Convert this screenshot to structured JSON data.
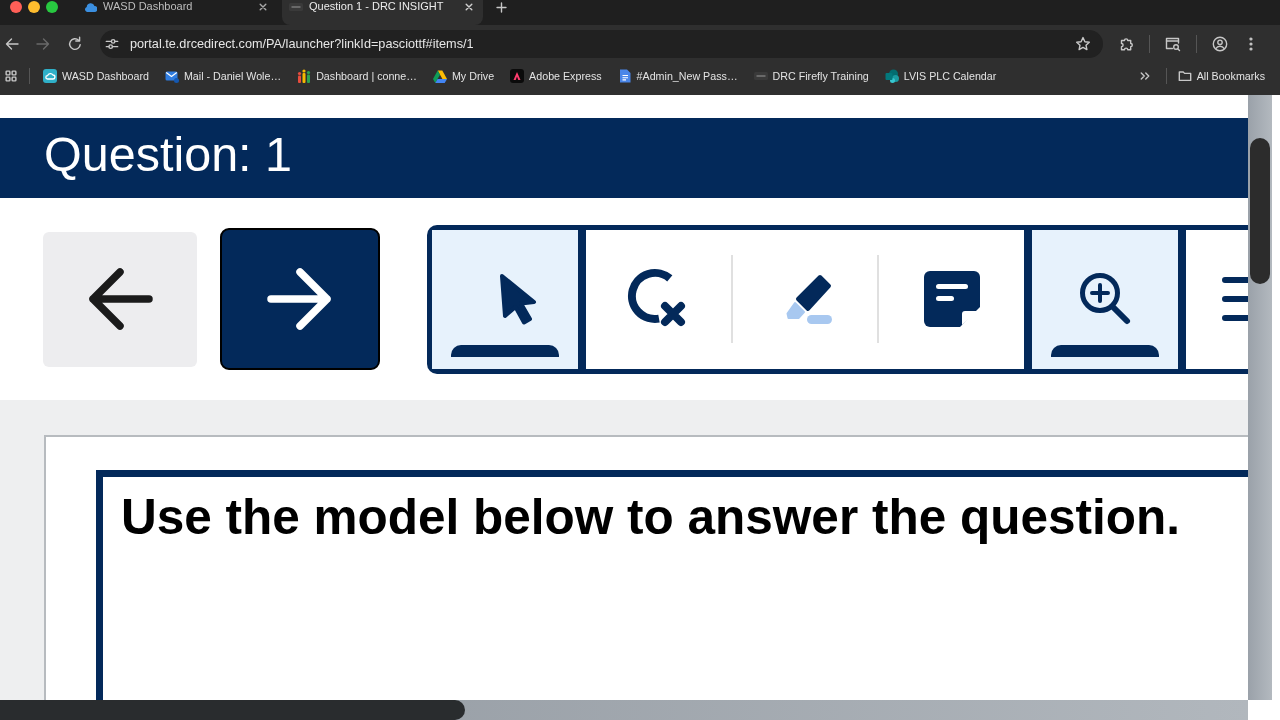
{
  "browser": {
    "tabs": [
      {
        "title": "WASD Dashboard",
        "selected": false
      },
      {
        "title": "Question 1 - DRC INSIGHT",
        "selected": true
      }
    ],
    "nav_buttons": [
      {
        "kind": "back",
        "disabled": false
      },
      {
        "kind": "forward",
        "disabled": true
      },
      {
        "kind": "reload",
        "disabled": false
      }
    ],
    "address_bar": {
      "url": "portal.te.drcedirect.com/PA/launcher?linkId=pasciottf#items/1"
    },
    "bookmarks": [
      {
        "label": "WASD Dashboard"
      },
      {
        "label": "Mail - Daniel Wole…"
      },
      {
        "label": "Dashboard | conne…"
      },
      {
        "label": "My Drive"
      },
      {
        "label": "Adobe Express"
      },
      {
        "label": "#Admin_New Pass…"
      },
      {
        "label": "DRC Firefly Training"
      },
      {
        "label": "LVIS PLC Calendar"
      }
    ],
    "all_bookmarks": {
      "label": "All Bookmarks"
    }
  },
  "test": {
    "header": {
      "title": "Question: 1"
    },
    "navigation": [
      {
        "kind": "previous",
        "disabled": true
      },
      {
        "kind": "next",
        "disabled": false
      }
    ],
    "tool_groups": [
      {
        "tools": [
          {
            "kind": "pointer",
            "selected": true
          }
        ]
      },
      {
        "tools": [
          {
            "kind": "eliminator",
            "selected": false
          },
          {
            "kind": "highlighter",
            "selected": false
          },
          {
            "kind": "note",
            "selected": false
          }
        ]
      },
      {
        "tools": [
          {
            "kind": "zoom",
            "selected": true
          }
        ]
      },
      {
        "tools": [
          {
            "kind": "menu",
            "selected": false
          }
        ]
      }
    ],
    "passage": {
      "text": "Use the model below to answer the question."
    }
  }
}
